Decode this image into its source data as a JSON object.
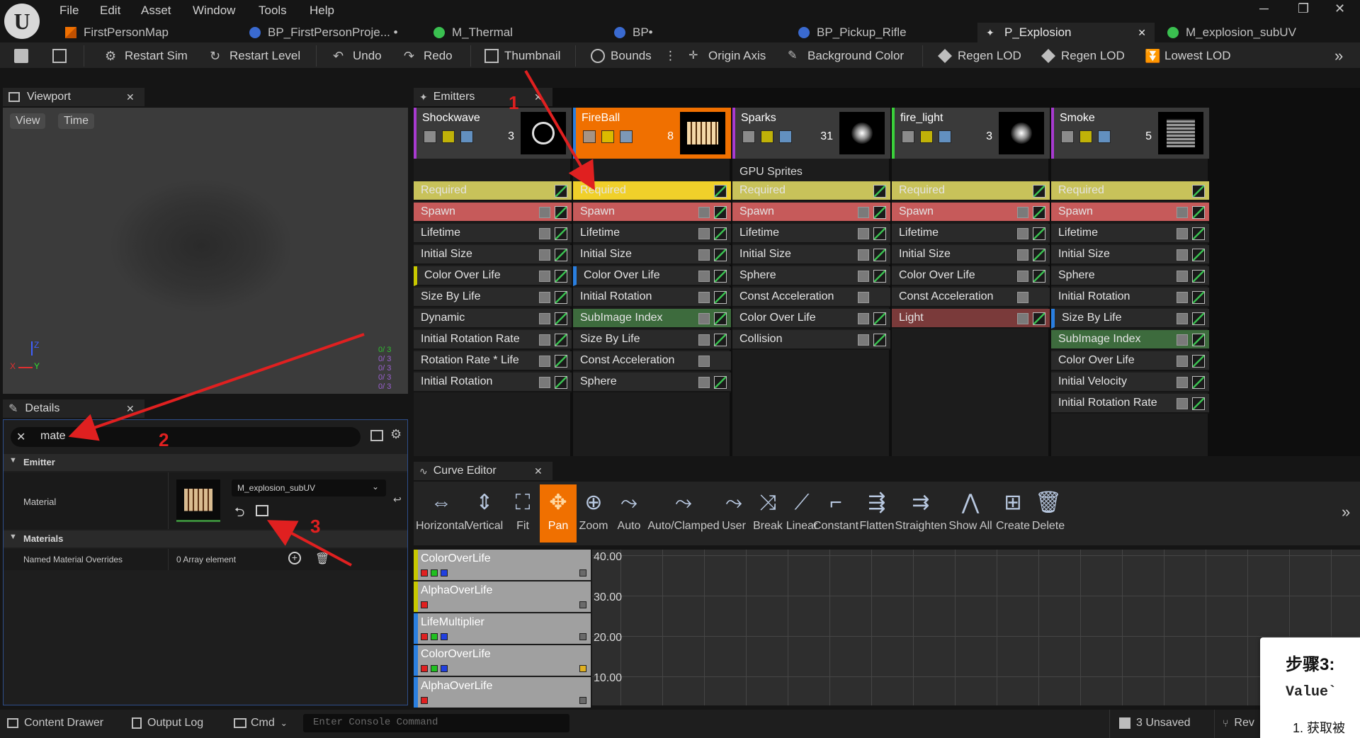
{
  "app": {
    "menu": [
      "File",
      "Edit",
      "Asset",
      "Window",
      "Tools",
      "Help"
    ],
    "tabs": [
      {
        "label": "FirstPersonMap"
      },
      {
        "label": "BP_FirstPersonProje... •"
      },
      {
        "label": "M_Thermal"
      },
      {
        "label": "BP•"
      },
      {
        "label": "BP_Pickup_Rifle"
      },
      {
        "label": "P_Explosion"
      },
      {
        "label": "M_explosion_subUV"
      }
    ]
  },
  "toolbar": {
    "restart_sim": "Restart Sim",
    "restart_level": "Restart Level",
    "undo": "Undo",
    "redo": "Redo",
    "thumbnail": "Thumbnail",
    "bounds": "Bounds",
    "origin_axis": "Origin Axis",
    "background_color": "Background Color",
    "regen_lod_1": "Regen LOD",
    "regen_lod_2": "Regen LOD",
    "lowest_lod": "Lowest LOD"
  },
  "viewport": {
    "title": "Viewport",
    "view_btn": "View",
    "time_btn": "Time",
    "axis_z": "Z",
    "axis_x": "X",
    "axis_y": "Y",
    "stats": [
      "0/ 3",
      "0/ 3",
      "0/ 3",
      "0/ 3",
      "0/ 3"
    ]
  },
  "details": {
    "title": "Details",
    "search_value": "mate",
    "section_emitter": "Emitter",
    "material_label": "Material",
    "material_value": "M_explosion_subUV",
    "section_materials": "Materials",
    "named_overrides_label": "Named Material Overrides",
    "named_overrides_value": "0 Array element"
  },
  "emitters": {
    "title": "Emitters",
    "gpu_label": "GPU Sprites",
    "columns": [
      {
        "name": "Shockwave",
        "count": "3",
        "color": "#a83ad0",
        "modules": [
          "Required",
          "Spawn",
          "Lifetime",
          "Initial Size",
          "Color Over Life",
          "Size By Life",
          "Dynamic",
          "Initial Rotation Rate",
          "Rotation Rate * Life",
          "Initial Rotation"
        ]
      },
      {
        "name": "FireBall",
        "count": "8",
        "color": "#2a7fe0",
        "modules": [
          "Required",
          "Spawn",
          "Lifetime",
          "Initial Size",
          "Color Over Life",
          "Initial Rotation",
          "SubImage Index",
          "Size By Life",
          "Const Acceleration",
          "Sphere"
        ]
      },
      {
        "name": "Sparks",
        "count": "31",
        "color": "#a83ad0",
        "modules": [
          "Required",
          "Spawn",
          "Lifetime",
          "Initial Size",
          "Sphere",
          "Const Acceleration",
          "Color Over Life",
          "Collision"
        ]
      },
      {
        "name": "fire_light",
        "count": "3",
        "color": "#3ad03a",
        "modules": [
          "Required",
          "Spawn",
          "Lifetime",
          "Initial Size",
          "Color Over Life",
          "Const Acceleration",
          "Light"
        ]
      },
      {
        "name": "Smoke",
        "count": "5",
        "color": "#a83ad0",
        "modules": [
          "Required",
          "Spawn",
          "Lifetime",
          "Initial Size",
          "Sphere",
          "Initial Rotation",
          "Size By Life",
          "SubImage Index",
          "Color Over Life",
          "Initial Velocity",
          "Initial Rotation Rate"
        ]
      }
    ]
  },
  "curve_editor": {
    "title": "Curve Editor",
    "buttons": [
      "Horizontal",
      "Vertical",
      "Fit",
      "Pan",
      "Zoom",
      "Auto",
      "Auto/Clamped",
      "User",
      "Break",
      "Linear",
      "Constant",
      "Flatten",
      "Straighten",
      "Show All",
      "Create",
      "Delete"
    ],
    "curves": [
      "ColorOverLife",
      "AlphaOverLife",
      "LifeMultiplier",
      "ColorOverLife",
      "AlphaOverLife"
    ],
    "y_labels": [
      "40.00",
      "30.00",
      "20.00",
      "10.00"
    ]
  },
  "statusbar": {
    "content_drawer": "Content Drawer",
    "output_log": "Output Log",
    "cmd": "Cmd",
    "console_placeholder": "Enter Console Command",
    "unsaved": "3 Unsaved",
    "revision": "Rev"
  },
  "annotations": {
    "n1": "1",
    "n2": "2",
    "n3": "3",
    "overlay_title": "步骤3: ",
    "overlay_code": "Value`",
    "overlay_item": "1.  获取被"
  },
  "colors": {
    "accent_orange": "#f07000",
    "required_yellow": "#c8c25a",
    "spawn_red": "#c65a5a",
    "annotation_red": "#e02020"
  }
}
